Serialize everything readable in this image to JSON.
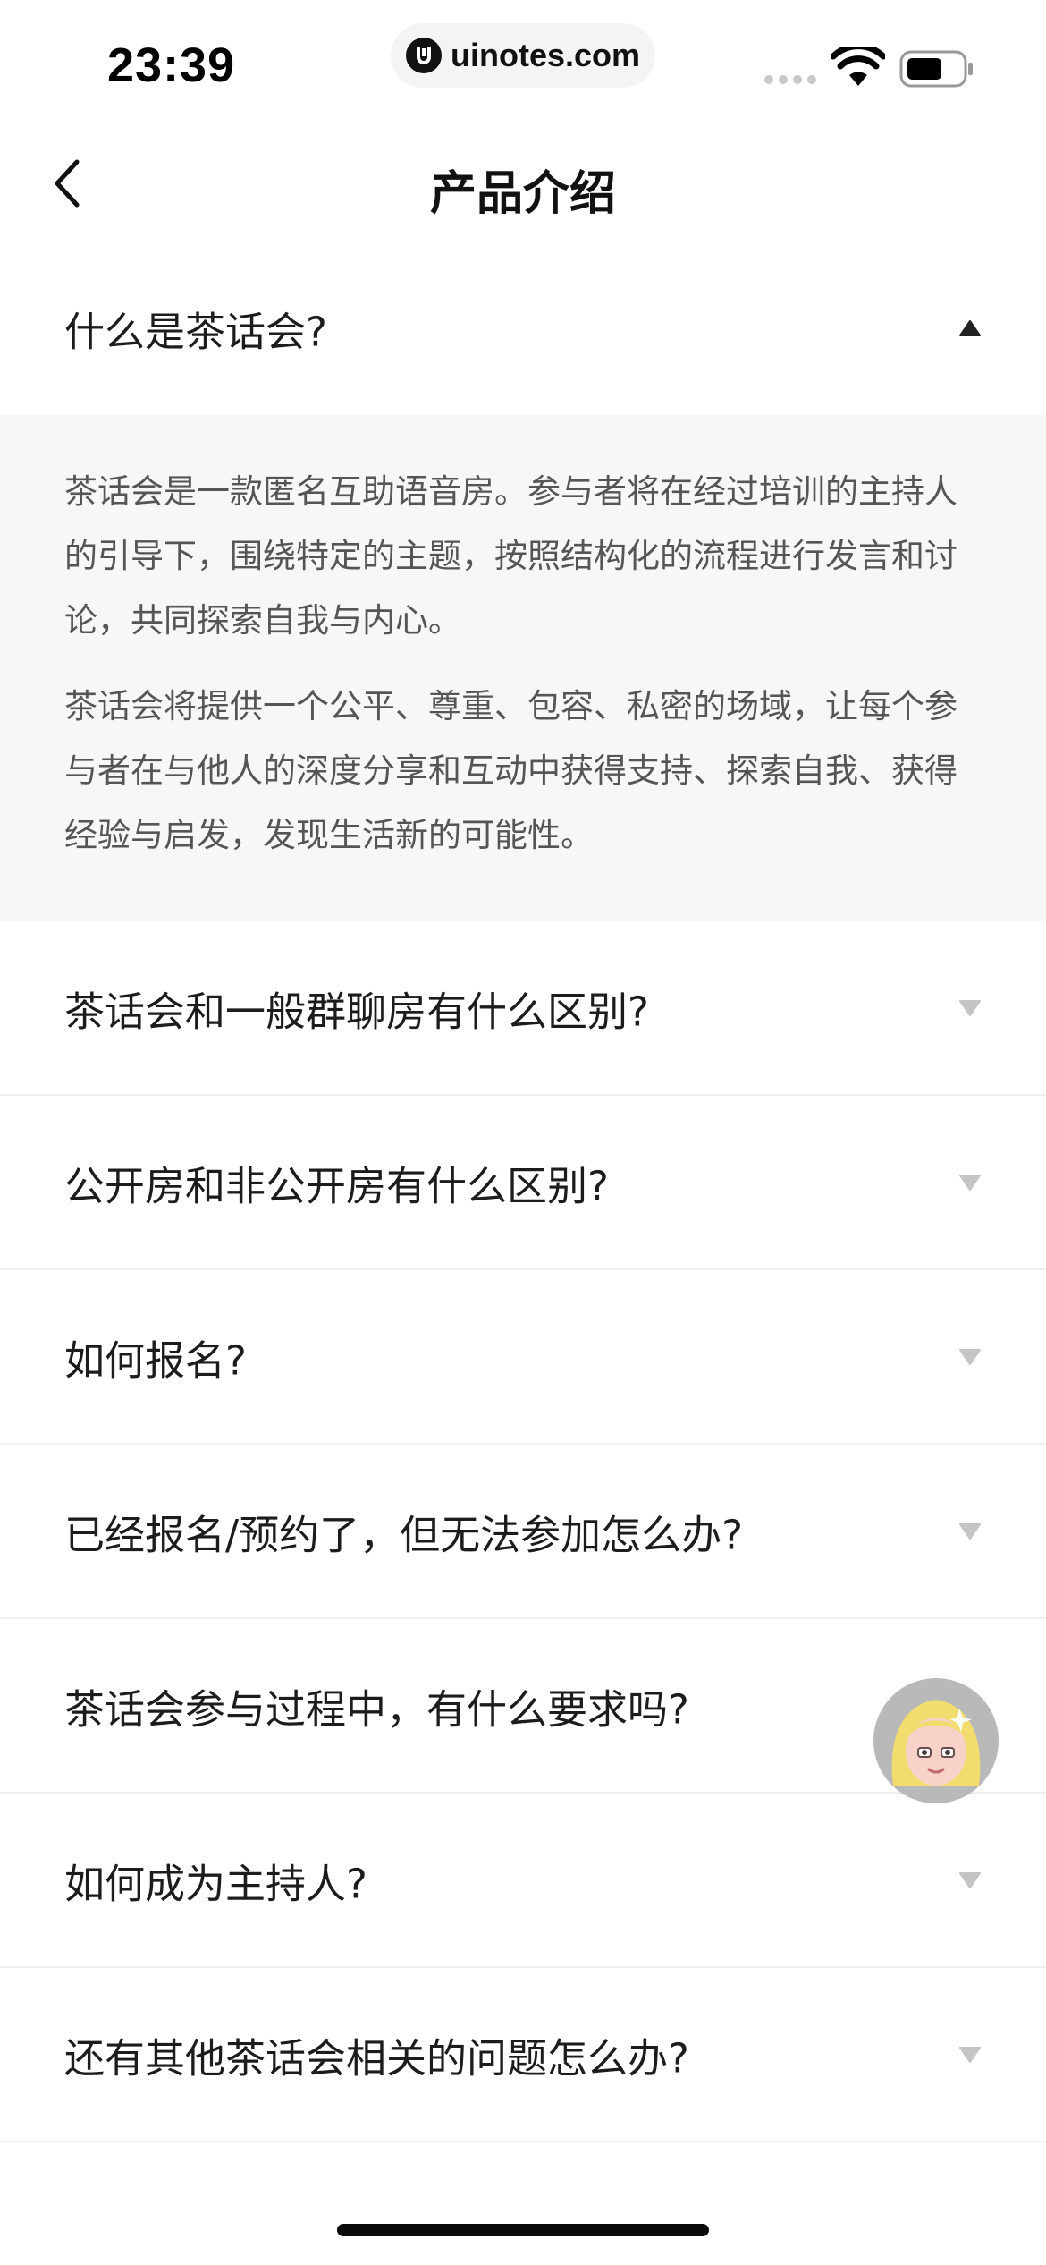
{
  "status_bar": {
    "time": "23:39",
    "url": "uinotes.com"
  },
  "nav": {
    "title": "产品介绍",
    "back_icon": "chevron-left-icon"
  },
  "faq": [
    {
      "question": "什么是茶话会?",
      "expanded": true,
      "answer": [
        "茶话会是一款匿名互助语音房。参与者将在经过培训的主持人的引导下，围绕特定的主题，按照结构化的流程进行发言和讨论，共同探索自我与内心。",
        "茶话会将提供一个公平、尊重、包容、私密的场域，让每个参与者在与他人的深度分享和互动中获得支持、探索自我、获得经验与启发，发现生活新的可能性。"
      ]
    },
    {
      "question": "茶话会和一般群聊房有什么区别?",
      "expanded": false
    },
    {
      "question": "公开房和非公开房有什么区别?",
      "expanded": false
    },
    {
      "question": "如何报名?",
      "expanded": false
    },
    {
      "question": "已经报名/预约了，但无法参加怎么办?",
      "expanded": false
    },
    {
      "question": "茶话会参与过程中，有什么要求吗?",
      "expanded": false
    },
    {
      "question": "如何成为主持人?",
      "expanded": false
    },
    {
      "question": "还有其他茶话会相关的问题怎么办?",
      "expanded": false
    }
  ],
  "colors": {
    "answer_bg": "#f7f7f7",
    "caret": "#c4c4c4",
    "caret_open": "#222222"
  }
}
